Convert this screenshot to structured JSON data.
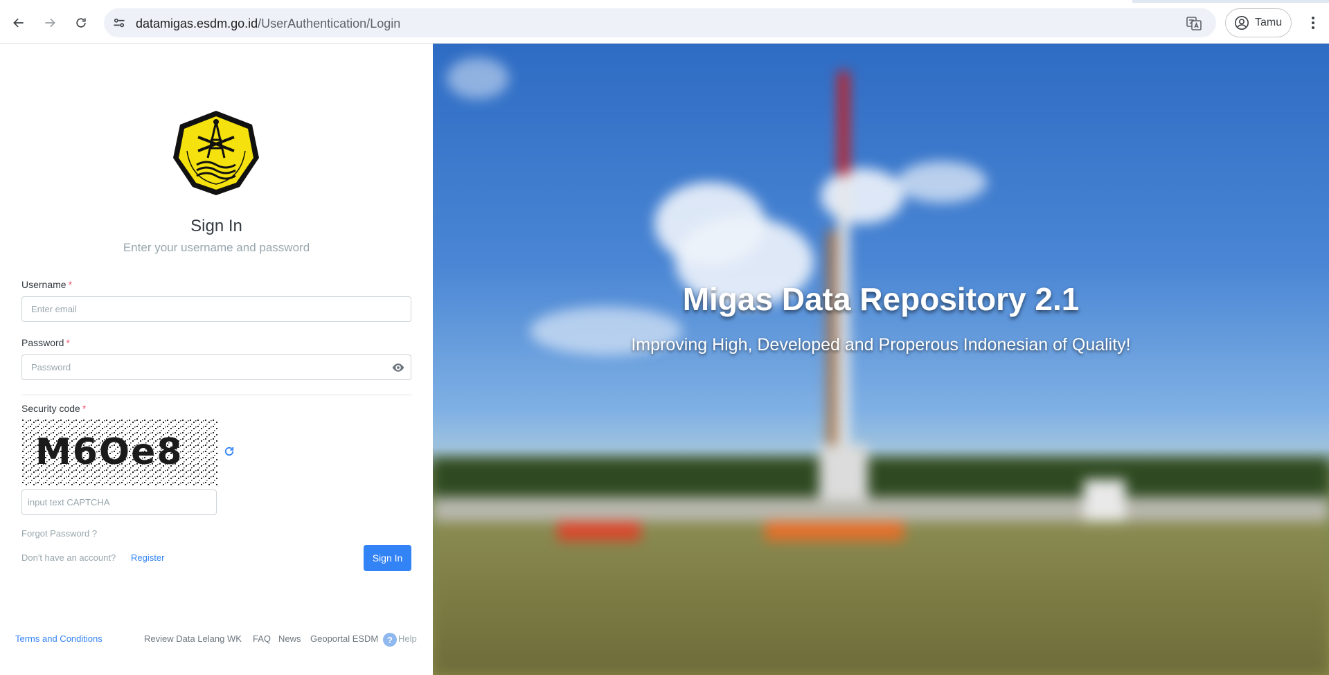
{
  "browser": {
    "url_host": "datamigas.esdm.go.id",
    "url_path": "/UserAuthentication/Login",
    "profile_name": "Tamu"
  },
  "login": {
    "title": "Sign In",
    "subtitle": "Enter your username and password",
    "username_label": "Username",
    "username_placeholder": "Enter email",
    "password_label": "Password",
    "password_placeholder": "Password",
    "security_label": "Security code",
    "required_mark": "*",
    "captcha_code": "M6Oe8",
    "captcha_placeholder": "input text CAPTCHA",
    "forgot_password": "Forgot Password ?",
    "no_account": "Don't have an account?",
    "register": "Register",
    "sign_in_button": "Sign In"
  },
  "footer": {
    "terms": "Terms and Conditions",
    "review": "Review Data Lelang WK",
    "faq": "FAQ",
    "news": "News",
    "geoportal": "Geoportal ESDM",
    "help_badge": "?",
    "help": "Help"
  },
  "hero": {
    "title": "Migas Data Repository 2.1",
    "subtitle": "Improving High, Developed and Properous Indonesian of Quality!"
  },
  "colors": {
    "primary": "#3283f6",
    "required": "#f1556c",
    "muted": "#98a6ad"
  }
}
